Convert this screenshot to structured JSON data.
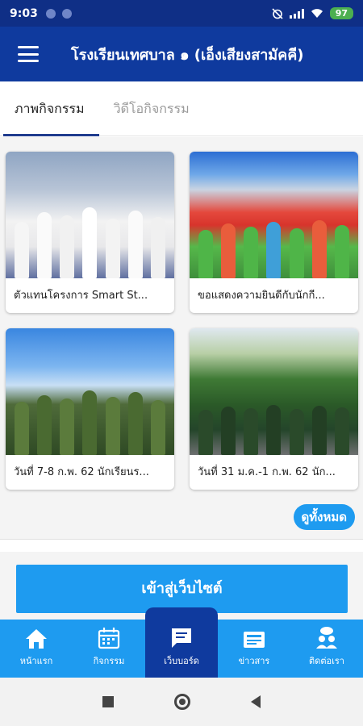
{
  "status_bar": {
    "time": "9:03",
    "battery": "97"
  },
  "app_bar": {
    "title": "โรงเรียนเทศบาล ๑ (เอ็งเสียงสามัคคี)"
  },
  "tabs": [
    {
      "label": "ภาพกิจกรรม",
      "active": true
    },
    {
      "label": "วิดีโอกิจกรรม",
      "active": false
    }
  ],
  "gallery": {
    "items": [
      {
        "caption": "ตัวแทนโครงการ Smart St..."
      },
      {
        "caption": "ขอแสดงความยินดีกับนักกี..."
      },
      {
        "caption": "วันที่ 7-8 ก.พ. 62 นักเรียนร..."
      },
      {
        "caption": "วันที่ 31 ม.ค.-1 ก.พ. 62 นัก..."
      }
    ],
    "view_all_label": "ดูทั้งหมด"
  },
  "website_button_label": "เข้าสู่เว็บไซต์",
  "bottom_nav": [
    {
      "label": "หน้าแรก",
      "icon": "home-icon",
      "active": false
    },
    {
      "label": "กิจกรรม",
      "icon": "calendar-icon",
      "active": false
    },
    {
      "label": "เว็บบอร์ด",
      "icon": "message-icon",
      "active": true
    },
    {
      "label": "ข่าวสาร",
      "icon": "newspaper-icon",
      "active": false
    },
    {
      "label": "ติดต่อเรา",
      "icon": "contact-icon",
      "active": false
    }
  ],
  "colors": {
    "primary_dark": "#0f3a9e",
    "accent": "#1e9bf0",
    "battery": "#4caf50"
  }
}
